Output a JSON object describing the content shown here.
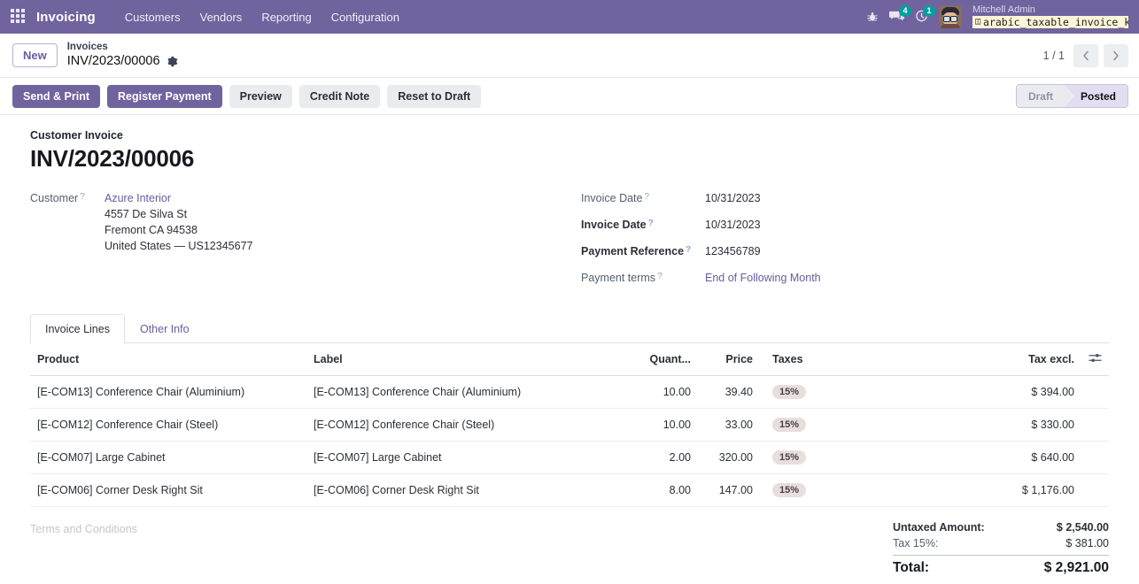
{
  "navbar": {
    "apps_icon": "apps-grid-icon",
    "brand": "Invoicing",
    "menu": [
      {
        "label": "Customers"
      },
      {
        "label": "Vendors"
      },
      {
        "label": "Reporting"
      },
      {
        "label": "Configuration"
      }
    ],
    "sys": {
      "bug_icon": "bug-icon",
      "messages_icon": "messages-icon",
      "messages_count": "4",
      "activities_icon": "clock-icon",
      "activities_count": "1"
    },
    "user": {
      "name": "Mitchell Admin",
      "db_icon": "database-icon",
      "database": "arabic_taxable_invoice_k…"
    },
    "accent": "#71639e"
  },
  "breadcrumb": {
    "new_label": "New",
    "parent": "Invoices",
    "current": "INV/2023/00006",
    "gear_icon": "gear-icon",
    "pager": {
      "value": "1 / 1",
      "prev_icon": "chevron-left-icon",
      "next_icon": "chevron-right-icon"
    }
  },
  "actions": {
    "buttons": [
      {
        "label": "Send & Print",
        "style": "primary"
      },
      {
        "label": "Register Payment",
        "style": "primary"
      },
      {
        "label": "Preview",
        "style": "secondary"
      },
      {
        "label": "Credit Note",
        "style": "secondary"
      },
      {
        "label": "Reset to Draft",
        "style": "secondary"
      }
    ],
    "status": [
      {
        "label": "Draft",
        "active": false
      },
      {
        "label": "Posted",
        "active": true
      }
    ]
  },
  "sheet": {
    "doc_type": "Customer Invoice",
    "doc_title": "INV/2023/00006",
    "customer": {
      "label": "Customer",
      "name": "Azure Interior",
      "street": "4557 De Silva St",
      "city": "Fremont CA 94538",
      "country": "United States — US12345677"
    },
    "fields": {
      "invoice_date_label": "Invoice Date",
      "invoice_date_value": "10/31/2023",
      "invoice_date_label2": "Invoice Date",
      "invoice_date_value2": "10/31/2023",
      "payment_reference_label": "Payment Reference",
      "payment_reference_value": "123456789",
      "payment_terms_label": "Payment terms",
      "payment_terms_value": "End of Following Month"
    }
  },
  "tabs": [
    {
      "label": "Invoice Lines",
      "active": true
    },
    {
      "label": "Other Info",
      "active": false
    }
  ],
  "table": {
    "columns": {
      "product": "Product",
      "label": "Label",
      "quantity": "Quant...",
      "price": "Price",
      "taxes": "Taxes",
      "tax_excl": "Tax excl.",
      "options_icon": "sliders-icon"
    },
    "rows": [
      {
        "product": "[E-COM13] Conference Chair (Aluminium)",
        "label": "[E-COM13] Conference Chair (Aluminium)",
        "quantity": "10.00",
        "price": "39.40",
        "tax": "15%",
        "subtotal": "$ 394.00"
      },
      {
        "product": "[E-COM12] Conference Chair (Steel)",
        "label": "[E-COM12] Conference Chair (Steel)",
        "quantity": "10.00",
        "price": "33.00",
        "tax": "15%",
        "subtotal": "$ 330.00"
      },
      {
        "product": "[E-COM07] Large Cabinet",
        "label": "[E-COM07] Large Cabinet",
        "quantity": "2.00",
        "price": "320.00",
        "tax": "15%",
        "subtotal": "$ 640.00"
      },
      {
        "product": "[E-COM06] Corner Desk Right Sit",
        "label": "[E-COM06] Corner Desk Right Sit",
        "quantity": "8.00",
        "price": "147.00",
        "tax": "15%",
        "subtotal": "$ 1,176.00"
      }
    ]
  },
  "footer": {
    "terms_placeholder": "Terms and Conditions",
    "totals": [
      {
        "label": "Untaxed Amount:",
        "value": "$ 2,540.00",
        "strong": true
      },
      {
        "label": "Tax 15%:",
        "value": "$ 381.00",
        "strong": false
      }
    ],
    "grand_label": "Total:",
    "grand_value": "$ 2,921.00"
  }
}
